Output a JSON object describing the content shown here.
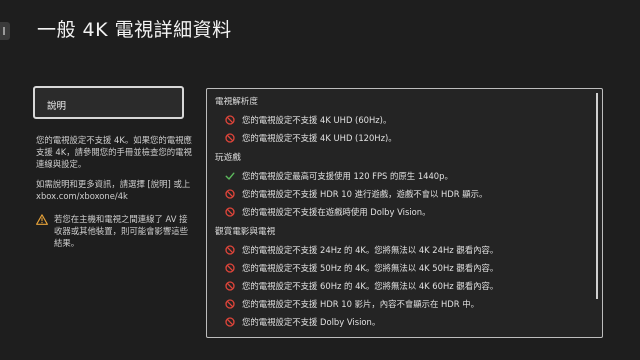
{
  "title": "一般 4K 電視詳細資料",
  "sidebar": {
    "button_label": "說明",
    "paragraph1": "您的電視設定不支援 4K。如果您的電視應支援 4K，請參閱您的手冊並檢查您的電視連線與設定。",
    "paragraph2": "如需說明和更多資訊，請選擇 [說明] 或上 xbox.com/xboxone/4k",
    "warning_icon": "warning-icon",
    "warning": "若您在主機和電視之間連線了 AV 接收器或其他裝置，則可能會影響這些結果。"
  },
  "colors": {
    "error": "#e0453a",
    "ok": "#5cb85c",
    "warning": "#e8a33a"
  },
  "sections": [
    {
      "title": "電視解析度",
      "items": [
        {
          "status": "error",
          "icon": "prohibited-icon",
          "text": "您的電視設定不支援 4K UHD (60Hz)。"
        },
        {
          "status": "error",
          "icon": "prohibited-icon",
          "text": "您的電視設定不支援 4K UHD (120Hz)。"
        }
      ]
    },
    {
      "title": "玩遊戲",
      "items": [
        {
          "status": "ok",
          "icon": "checkmark-icon",
          "text": "您的電視設定最高可支援使用 120 FPS 的原生 1440p。"
        },
        {
          "status": "error",
          "icon": "prohibited-icon",
          "text": "您的電視設定不支援 HDR 10 進行遊戲，遊戲不會以 HDR 顯示。"
        },
        {
          "status": "error",
          "icon": "prohibited-icon",
          "text": "您的電視設定不支援在遊戲時使用 Dolby Vision。"
        }
      ]
    },
    {
      "title": "觀賞電影與電視",
      "items": [
        {
          "status": "error",
          "icon": "prohibited-icon",
          "text": "您的電視設定不支援 24Hz 的 4K。您將無法以 4K 24Hz 觀看內容。"
        },
        {
          "status": "error",
          "icon": "prohibited-icon",
          "text": "您的電視設定不支援 50Hz 的 4K。您將無法以 4K 50Hz 觀看內容。"
        },
        {
          "status": "error",
          "icon": "prohibited-icon",
          "text": "您的電視設定不支援 60Hz 的 4K。您將無法以 4K 60Hz 觀看內容。"
        },
        {
          "status": "error",
          "icon": "prohibited-icon",
          "text": "您的電視設定不支援 HDR 10 影片，內容不會顯示在 HDR 中。"
        },
        {
          "status": "error",
          "icon": "prohibited-icon",
          "text": "您的電視設定不支援 Dolby Vision。"
        }
      ]
    }
  ]
}
